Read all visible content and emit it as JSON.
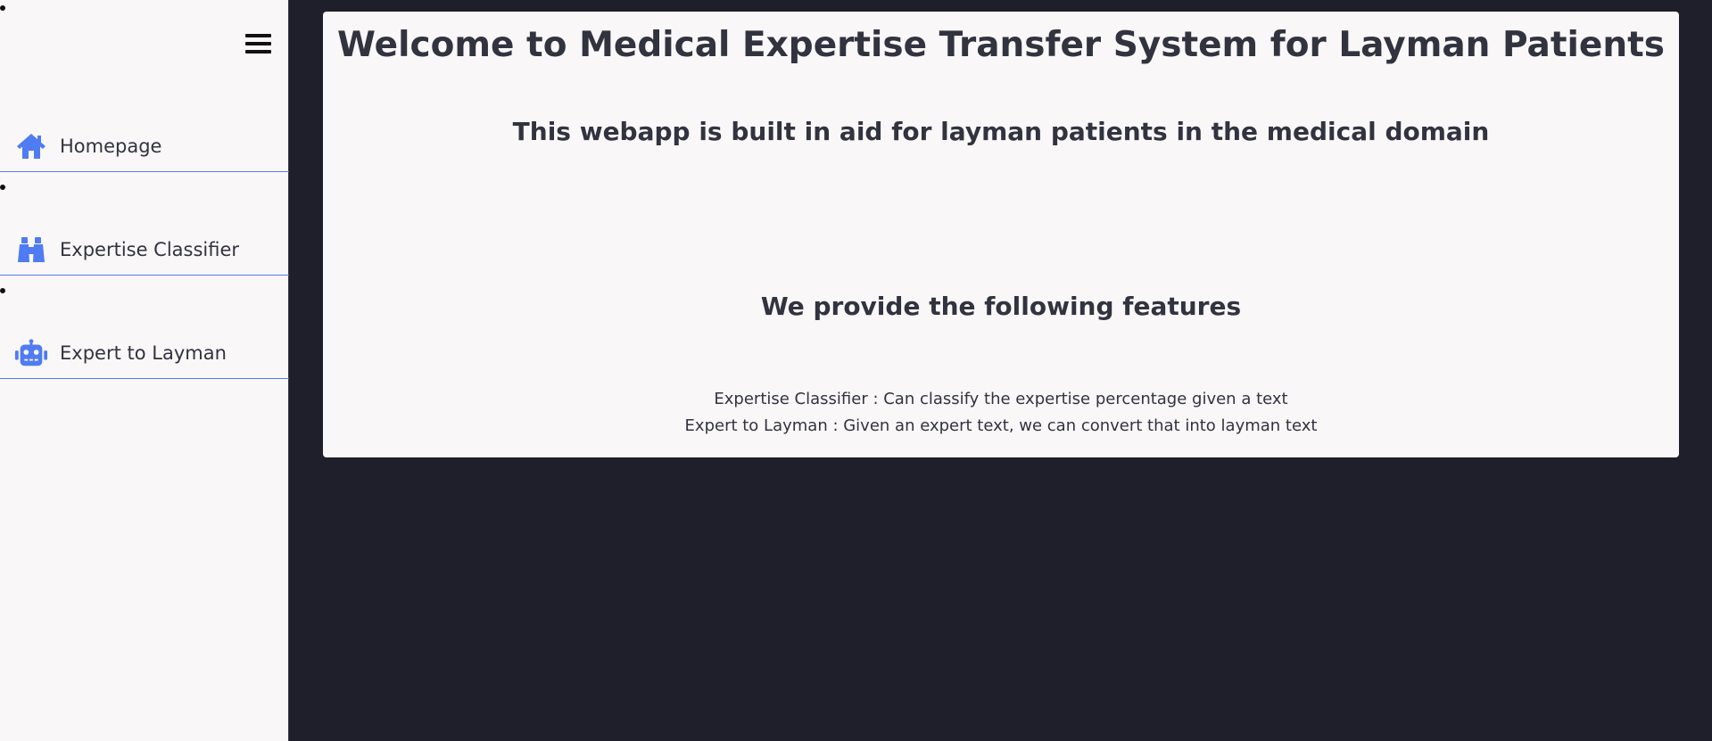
{
  "sidebar": {
    "menu_icon": "hamburger-menu-icon",
    "items": [
      {
        "label": "Homepage",
        "icon": "home-icon",
        "icon_color": "#4f7cf2"
      },
      {
        "label": "Expertise Classifier",
        "icon": "binoculars-icon",
        "icon_color": "#4f7cf2"
      },
      {
        "label": "Expert to Layman",
        "icon": "robot-icon",
        "icon_color": "#4f7cf2"
      }
    ]
  },
  "main": {
    "title": "Welcome to Medical Expertise Transfer System for Layman Patients",
    "subtitle": "This webapp is built in aid for layman patients in the medical domain",
    "features_heading": "We provide the following features",
    "features": [
      "Expertise Classifier : Can classify the expertise percentage given a text",
      "Expert to Layman : Given an expert text, we can convert that into layman text"
    ]
  },
  "colors": {
    "accent": "#4f7cf2",
    "page_background": "#1f1f2b",
    "card_background": "#faf7f8",
    "text": "#31333f"
  }
}
